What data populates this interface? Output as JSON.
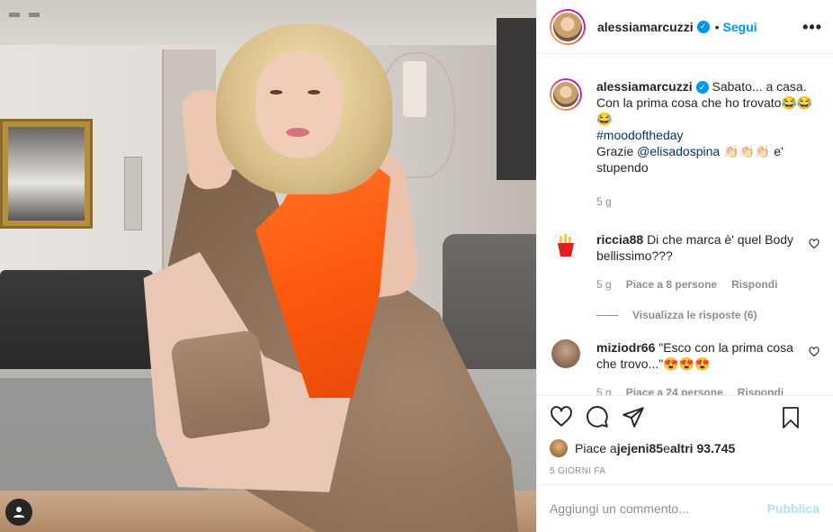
{
  "post": {
    "username": "alessiamarcuzzi",
    "follow_label": "Segui",
    "dot": "•",
    "more_label": "•••",
    "verified_mark": "✓"
  },
  "caption": {
    "username": "alessiamarcuzzi",
    "text_line1": "Sabato... a casa. Con la prima cosa che ho trovato😂😂😂",
    "hashtag": "#moodoftheday",
    "thanks_prefix": "Grazie ",
    "mention": "@elisadospina",
    "thanks_suffix": " 👏🏻👏🏻👏🏻 e' stupendo",
    "age": "5 g"
  },
  "comments": [
    {
      "username": "riccia88",
      "text": "Di che marca è' quel Body bellissimo???",
      "age": "5 g",
      "likes": "Piace a 8 persone",
      "reply": "Rispondi",
      "view_replies": "Visualizza le risposte (6)"
    },
    {
      "username": "miziodr66",
      "text": "\"Esco con la prima cosa che trovo...\"😍😍😍",
      "age": "5 g",
      "likes": "Piace a 24 persone",
      "reply": "Rispondi"
    }
  ],
  "likes_summary": {
    "prefix": "Piace a ",
    "user": "jejeni85",
    "middle": " e ",
    "others": "altri 93.745"
  },
  "time_ago": "5 GIORNI FA",
  "add_comment": {
    "placeholder": "Aggiungi un commento...",
    "publish_label": "Pubblica"
  },
  "icons": {
    "like": "heart-icon",
    "comment": "comment-bubble-icon",
    "share": "paper-plane-icon",
    "save": "bookmark-icon",
    "user_tags": "user-icon"
  },
  "colors": {
    "accent": "#0095f6",
    "publish_disabled": "#b2dffc",
    "muted": "#8e8e8e",
    "text": "#262626"
  }
}
